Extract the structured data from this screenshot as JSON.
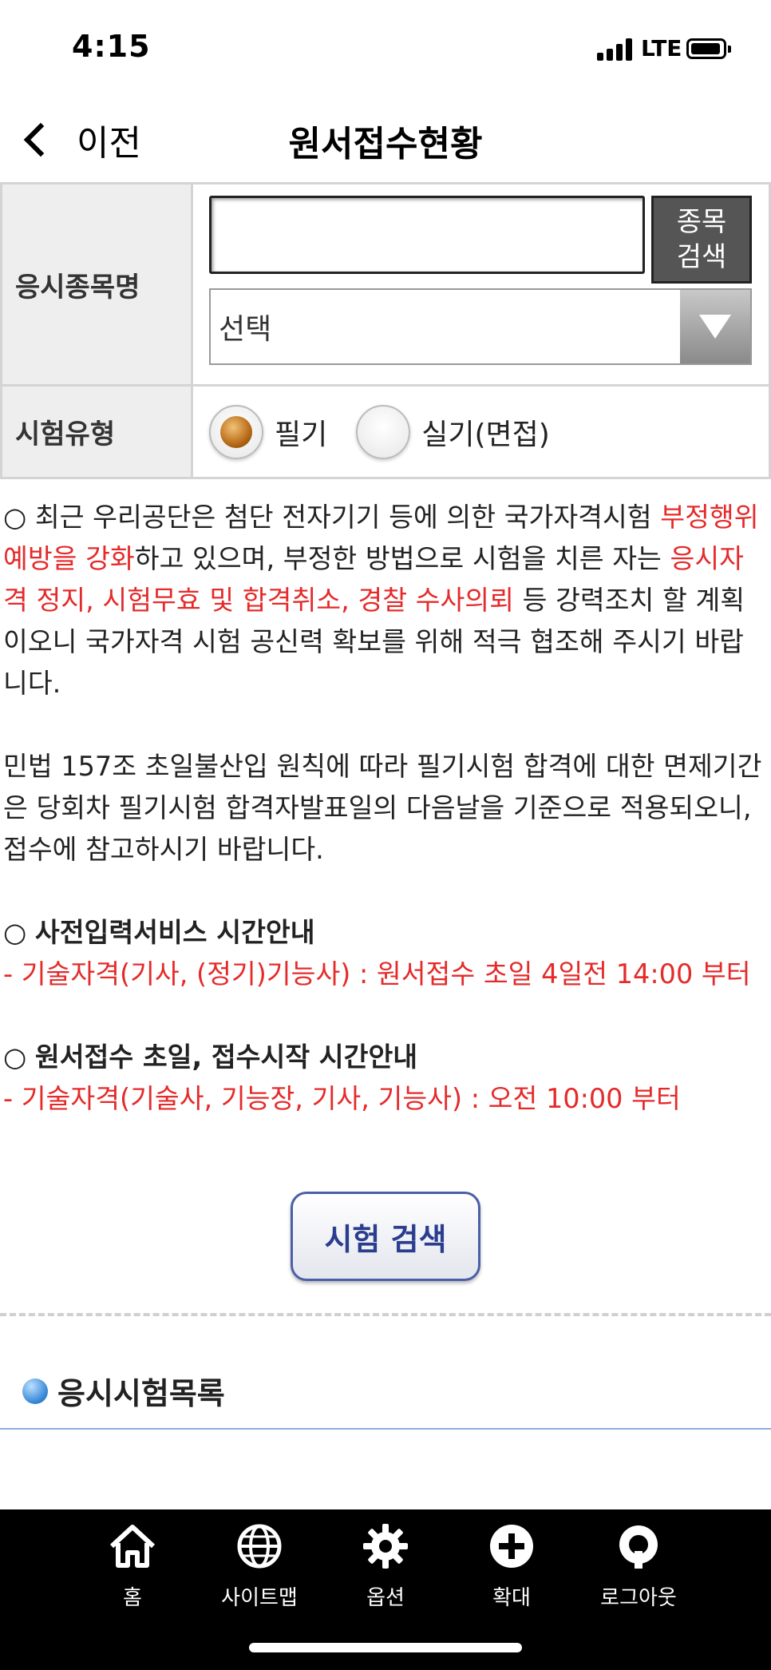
{
  "status_bar": {
    "time": "4:15",
    "network": "LTE"
  },
  "nav": {
    "back_label": "이전",
    "title": "원서접수현황"
  },
  "form": {
    "name_label": "응시종목명",
    "name_input_value": "",
    "search_item_button": "종목\n검색",
    "select_value": "선택",
    "type_label": "시험유형",
    "radio_options": [
      {
        "label": "필기",
        "checked": true
      },
      {
        "label": "실기(면접)",
        "checked": false
      }
    ]
  },
  "notice": {
    "para1": {
      "t1": "○ 최근 우리공단은 첨단 전자기기 등에 의한 국가자격시험 ",
      "r1": "부정행위 예방을 강화",
      "t2": "하고 있으며, 부정한 방법으로 시험을 치른 자는 ",
      "r2": "응시자격 정지, 시험무효 및 합격취소, 경찰 수사의뢰",
      "t3": " 등 강력조치 할 계획이오니 국가자격 시험 공신력 확보를 위해 적극 협조해 주시기 바랍니다."
    },
    "para2": "민법 157조 초일불산입 원칙에 따라 필기시험 합격에 대한 면제기간은 당회차 필기시험 합격자발표일의 다음날을 기준으로 적용되오니, 접수에 참고하시기 바랍니다.",
    "section1_heading": "사전입력서비스 시간안내",
    "section1_bullet": "○ ",
    "section1_text": "- 기술자격(기사, (정기)기능사) : 원서접수 초일 4일전 14:00 부터",
    "section2_heading": "원서접수 초일, 접수시작 시간안내",
    "section2_bullet": "○ ",
    "section2_text": "- 기술자격(기술사, 기능장, 기사, 기능사) : 오전 10:00 부터"
  },
  "exam_search_button": "시험 검색",
  "list_title": "응시시험목록",
  "bottom_nav": [
    {
      "label": "홈",
      "icon": "home-icon"
    },
    {
      "label": "사이트맵",
      "icon": "globe-icon"
    },
    {
      "label": "옵션",
      "icon": "gear-icon"
    },
    {
      "label": "확대",
      "icon": "plus-circle-icon"
    },
    {
      "label": "로그아웃",
      "icon": "power-icon"
    }
  ]
}
